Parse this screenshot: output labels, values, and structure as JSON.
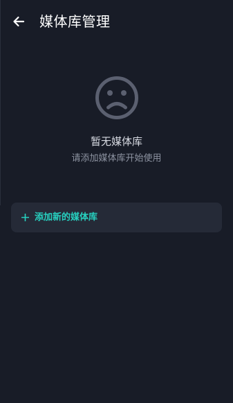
{
  "header": {
    "title": "媒体库管理",
    "back_icon": "arrow-left-icon"
  },
  "empty_state": {
    "icon": "sad-face-icon",
    "title": "暂无媒体库",
    "subtitle": "请添加媒体库开始使用"
  },
  "add_button": {
    "icon": "plus-icon",
    "label": "添加新的媒体库"
  },
  "colors": {
    "background": "#181c27",
    "card": "#252a37",
    "accent": "#27d1c0",
    "icon_muted": "#5b6070"
  }
}
